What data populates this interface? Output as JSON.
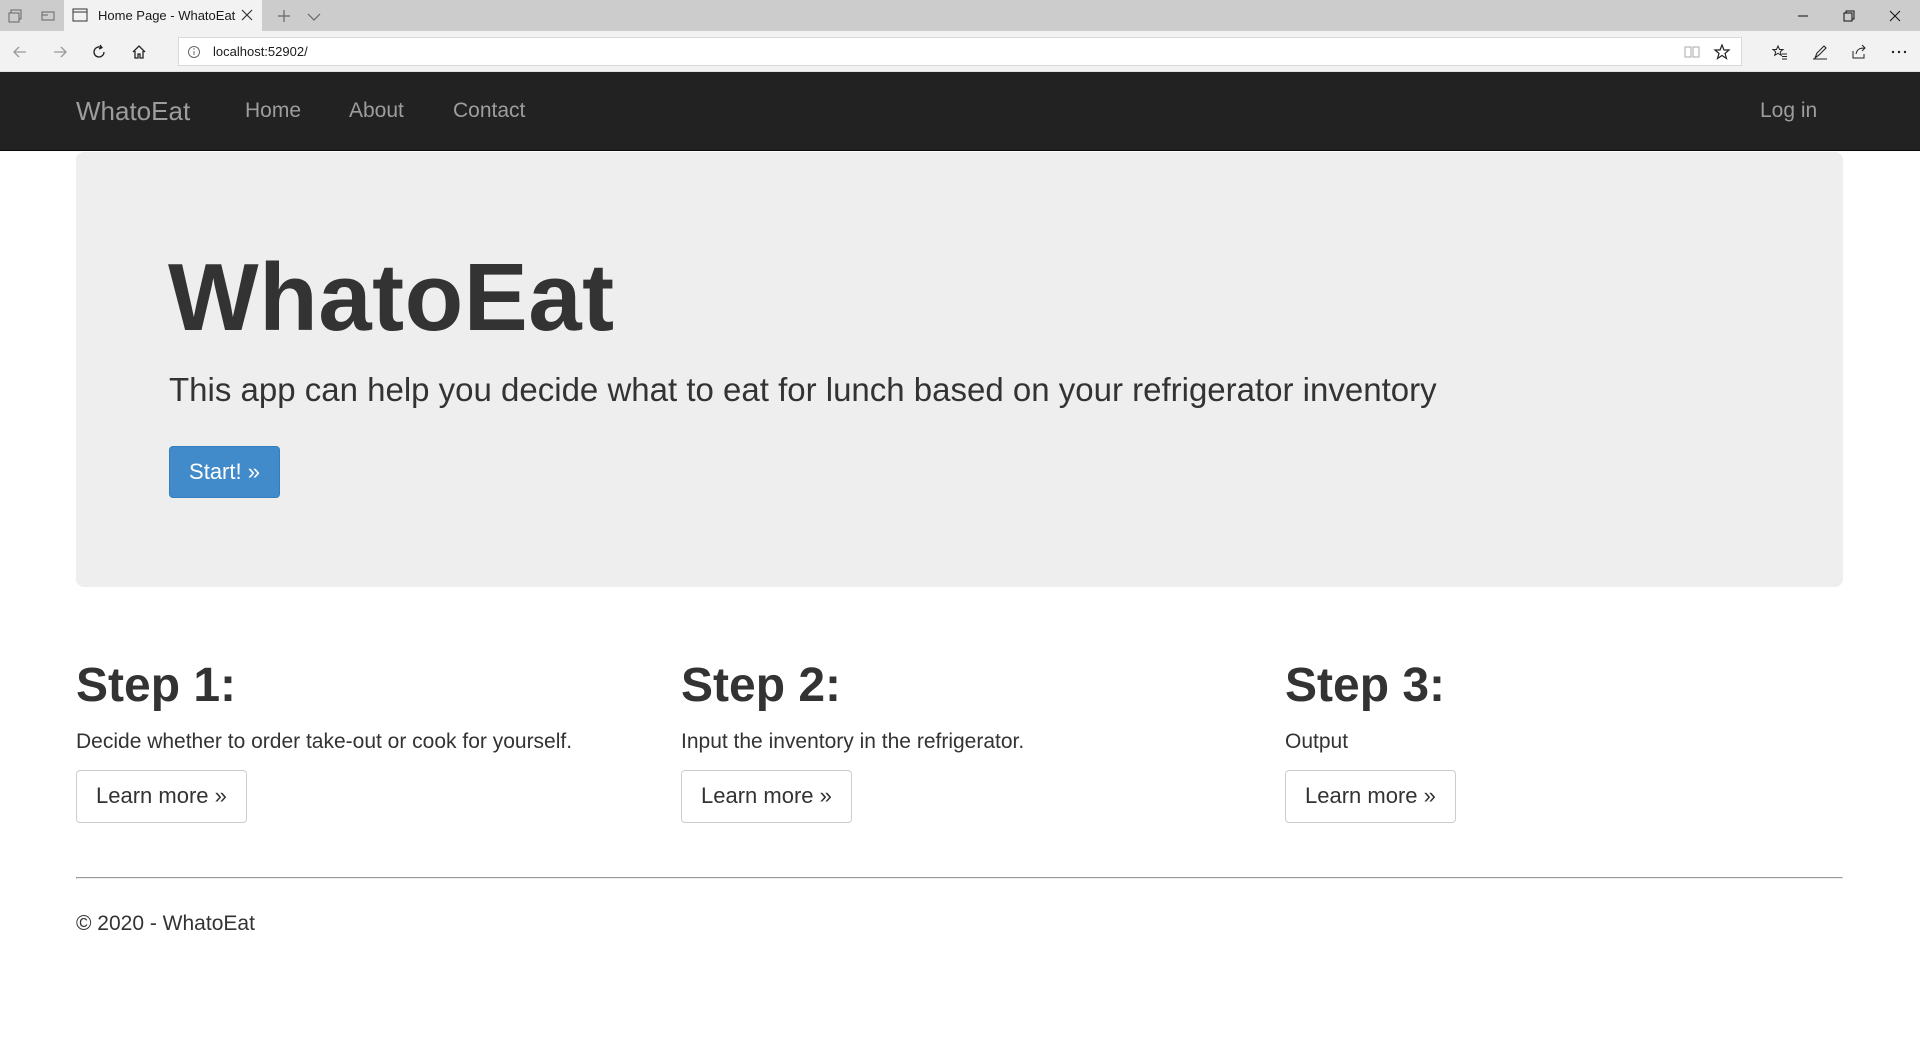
{
  "browser": {
    "tab_title": "Home Page - WhatoEat",
    "url": "localhost:52902/",
    "icons": [
      "set-aside-tabs-icon",
      "tab-preview-icon",
      "page-icon",
      "close-icon",
      "new-tab-icon",
      "chevron-down-icon",
      "minimize-icon",
      "restore-icon",
      "window-close-icon",
      "back-icon",
      "forward-icon",
      "refresh-icon",
      "home-icon",
      "info-icon",
      "reading-view-icon",
      "star-icon",
      "favorites-icon",
      "pen-icon",
      "share-icon",
      "more-icon"
    ]
  },
  "navbar": {
    "brand": "WhatoEat",
    "links": [
      "Home",
      "About",
      "Contact"
    ],
    "login": "Log in"
  },
  "jumbotron": {
    "title": "WhatoEat",
    "lead": "This app can help you decide what to eat for lunch based on your refrigerator inventory",
    "button": "Start! »",
    "button_color": "#428bca"
  },
  "steps": [
    {
      "title": "Step 1:",
      "text": "Decide whether to order take-out or cook for yourself.",
      "button": "Learn more »"
    },
    {
      "title": "Step 2:",
      "text": "Input the inventory in the refrigerator.",
      "button": "Learn more »"
    },
    {
      "title": "Step 3:",
      "text": "Output",
      "button": "Learn more »"
    }
  ],
  "footer": {
    "text": "© 2020 - WhatoEat"
  },
  "colors": {
    "navbar_bg": "#222222",
    "navbar_text": "#9d9d9d",
    "jumbotron_bg": "#eeeeee"
  }
}
